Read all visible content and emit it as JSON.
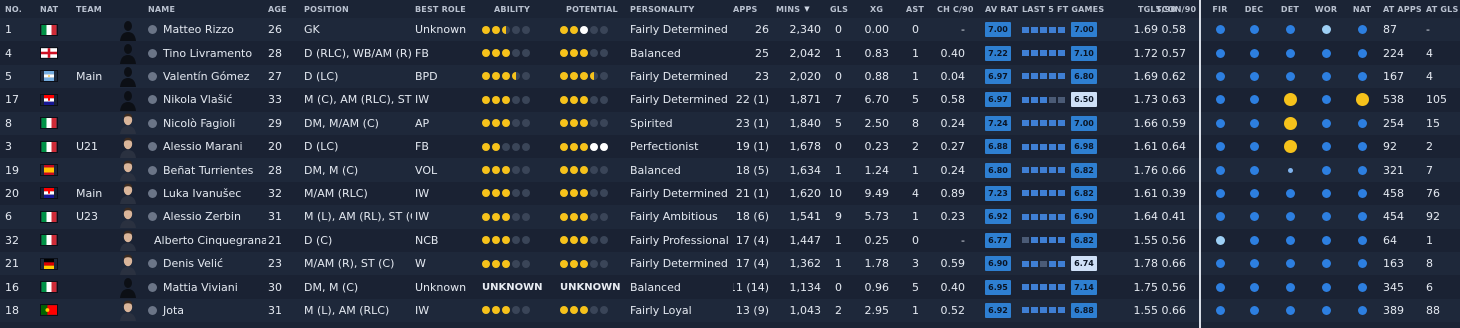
{
  "columns": {
    "no": "NO.",
    "nat": "NAT",
    "team": "TEAM",
    "name": "NAME",
    "age": "AGE",
    "position": "POSITION",
    "best_role": "BEST ROLE",
    "ability": "ABILITY",
    "potential": "POTENTIAL",
    "personality": "PERSONALITY",
    "apps": "APPS",
    "mins": "MINS",
    "mins_sort_icon": "▼",
    "gls": "GLS",
    "xg": "XG",
    "ast": "AST",
    "chc90": "CH C/90",
    "avrat": "AV RAT",
    "last5": "LAST 5 FT GAMES",
    "tgls90": "TGLS/90",
    "tcon90": "TCON/90",
    "fir": "FIR",
    "dec": "DEC",
    "det": "DET",
    "wor": "WOR",
    "nat2": "NAT",
    "atapps": "AT APPS",
    "atgls": "AT GLS"
  },
  "colors": {
    "background": "#1b2435",
    "row_alt": "#1e283a",
    "gold": "#f6c21b",
    "rating_blue": "#2e7fd1",
    "attr_blue": "#2d7fe0"
  },
  "players": [
    {
      "no": "1",
      "nat": "Italy",
      "flag": "it",
      "team": "",
      "name": "Matteo Rizzo",
      "age": "26",
      "position": "GK",
      "role": "Unknown",
      "ability": [
        "f",
        "f",
        "h",
        "e",
        "e"
      ],
      "potential": [
        "f",
        "f",
        "w",
        "e",
        "e"
      ],
      "ability_text": "",
      "potential_text": "",
      "personality": "Fairly Determined",
      "apps": "26",
      "mins": "2,340",
      "gls": "0",
      "xg": "0.00",
      "ast": "0",
      "chc90": "-",
      "avrat": "7.00",
      "avrat_light": false,
      "last5": [
        1,
        1,
        1,
        1,
        1
      ],
      "last5_rating": "7.00",
      "last5_light": false,
      "tgls90": "1.69",
      "tcon90": "0.58",
      "attrs": [
        "n",
        "n",
        "n",
        "l",
        "n"
      ],
      "atapps": "87",
      "atgls": "-",
      "photo": "silhouette"
    },
    {
      "no": "4",
      "nat": "England",
      "flag": "en",
      "team": "",
      "name": "Tino Livramento",
      "age": "28",
      "position": "D (RLC), WB/AM (R)",
      "role": "FB",
      "ability": [
        "f",
        "f",
        "f",
        "e",
        "e"
      ],
      "potential": [
        "f",
        "f",
        "f",
        "e",
        "e"
      ],
      "ability_text": "",
      "potential_text": "",
      "personality": "Balanced",
      "apps": "25",
      "mins": "2,042",
      "gls": "1",
      "xg": "0.83",
      "ast": "1",
      "chc90": "0.40",
      "avrat": "7.22",
      "avrat_light": false,
      "last5": [
        1,
        1,
        1,
        1,
        1
      ],
      "last5_rating": "7.10",
      "last5_light": false,
      "tgls90": "1.72",
      "tcon90": "0.57",
      "attrs": [
        "n",
        "n",
        "n",
        "n",
        "n"
      ],
      "atapps": "224",
      "atgls": "4",
      "photo": "silhouette"
    },
    {
      "no": "5",
      "nat": "Argentina",
      "flag": "ar",
      "team": "Main",
      "name": "Valentín Gómez",
      "age": "27",
      "position": "D (LC)",
      "role": "BPD",
      "ability": [
        "f",
        "f",
        "f",
        "h",
        "e"
      ],
      "potential": [
        "f",
        "f",
        "f",
        "h",
        "e"
      ],
      "ability_text": "",
      "potential_text": "",
      "personality": "Fairly Determined",
      "apps": "23",
      "mins": "2,020",
      "gls": "0",
      "xg": "0.88",
      "ast": "1",
      "chc90": "0.04",
      "avrat": "6.97",
      "avrat_light": false,
      "last5": [
        1,
        1,
        1,
        1,
        1
      ],
      "last5_rating": "6.80",
      "last5_light": false,
      "tgls90": "1.69",
      "tcon90": "0.62",
      "attrs": [
        "n",
        "n",
        "n",
        "n",
        "n"
      ],
      "atapps": "167",
      "atgls": "4",
      "photo": "silhouette"
    },
    {
      "no": "17",
      "nat": "Croatia",
      "flag": "hr",
      "team": "",
      "name": "Nikola Vlašić",
      "age": "33",
      "position": "M (C), AM (RLC), ST (C)",
      "role": "IW",
      "ability": [
        "f",
        "f",
        "f",
        "e",
        "e"
      ],
      "potential": [
        "f",
        "f",
        "f",
        "e",
        "e"
      ],
      "ability_text": "",
      "potential_text": "",
      "personality": "Fairly Determined",
      "apps": "22 (1)",
      "mins": "1,871",
      "gls": "7",
      "xg": "6.70",
      "ast": "5",
      "chc90": "0.58",
      "avrat": "6.97",
      "avrat_light": false,
      "last5": [
        1,
        1,
        1,
        0,
        0
      ],
      "last5_rating": "6.50",
      "last5_light": true,
      "tgls90": "1.73",
      "tcon90": "0.63",
      "attrs": [
        "n",
        "n",
        "g",
        "n",
        "g"
      ],
      "atapps": "538",
      "atgls": "105",
      "photo": "silhouette"
    },
    {
      "no": "8",
      "nat": "Italy",
      "flag": "it",
      "team": "",
      "name": "Nicolò Fagioli",
      "age": "29",
      "position": "DM, M/AM (C)",
      "role": "AP",
      "ability": [
        "f",
        "f",
        "f",
        "e",
        "e"
      ],
      "potential": [
        "f",
        "f",
        "f",
        "e",
        "e"
      ],
      "ability_text": "",
      "potential_text": "",
      "personality": "Spirited",
      "apps": "23 (1)",
      "mins": "1,840",
      "gls": "5",
      "xg": "2.50",
      "ast": "8",
      "chc90": "0.24",
      "avrat": "7.24",
      "avrat_light": false,
      "last5": [
        1,
        1,
        1,
        1,
        1
      ],
      "last5_rating": "7.00",
      "last5_light": false,
      "tgls90": "1.66",
      "tcon90": "0.59",
      "attrs": [
        "n",
        "n",
        "g",
        "n",
        "n"
      ],
      "atapps": "254",
      "atgls": "15",
      "photo": "face"
    },
    {
      "no": "3",
      "nat": "Italy",
      "flag": "it",
      "team": "U21",
      "name": "Alessio Marani",
      "age": "20",
      "position": "D (LC)",
      "role": "FB",
      "ability": [
        "f",
        "f",
        "e",
        "e",
        "e"
      ],
      "potential": [
        "f",
        "f",
        "f",
        "w",
        "w"
      ],
      "ability_text": "",
      "potential_text": "",
      "personality": "Perfectionist",
      "apps": "19 (1)",
      "mins": "1,678",
      "gls": "0",
      "xg": "0.23",
      "ast": "2",
      "chc90": "0.27",
      "avrat": "6.88",
      "avrat_light": false,
      "last5": [
        1,
        1,
        1,
        1,
        1
      ],
      "last5_rating": "6.98",
      "last5_light": false,
      "tgls90": "1.61",
      "tcon90": "0.64",
      "attrs": [
        "n",
        "n",
        "g",
        "n",
        "n"
      ],
      "atapps": "92",
      "atgls": "2",
      "photo": "face"
    },
    {
      "no": "19",
      "nat": "Spain",
      "flag": "es",
      "team": "",
      "name": "Beñat Turrientes",
      "age": "28",
      "position": "DM, M (C)",
      "role": "VOL",
      "ability": [
        "f",
        "f",
        "f",
        "e",
        "e"
      ],
      "potential": [
        "f",
        "f",
        "f",
        "e",
        "e"
      ],
      "ability_text": "",
      "potential_text": "",
      "personality": "Balanced",
      "apps": "18 (5)",
      "mins": "1,634",
      "gls": "1",
      "xg": "1.24",
      "ast": "1",
      "chc90": "0.24",
      "avrat": "6.80",
      "avrat_light": false,
      "last5": [
        1,
        1,
        1,
        1,
        1
      ],
      "last5_rating": "6.82",
      "last5_light": false,
      "tgls90": "1.76",
      "tcon90": "0.66",
      "attrs": [
        "n",
        "n",
        "s",
        "n",
        "n"
      ],
      "atapps": "321",
      "atgls": "7",
      "photo": "face"
    },
    {
      "no": "20",
      "nat": "Croatia",
      "flag": "hr",
      "team": "Main",
      "name": "Luka Ivanušec",
      "age": "32",
      "position": "M/AM (RLC)",
      "role": "IW",
      "ability": [
        "f",
        "f",
        "f",
        "e",
        "e"
      ],
      "potential": [
        "f",
        "f",
        "f",
        "e",
        "e"
      ],
      "ability_text": "",
      "potential_text": "",
      "personality": "Fairly Determined",
      "apps": "21 (1)",
      "mins": "1,620",
      "gls": "10",
      "xg": "9.49",
      "ast": "4",
      "chc90": "0.89",
      "avrat": "7.23",
      "avrat_light": false,
      "last5": [
        1,
        1,
        1,
        1,
        1
      ],
      "last5_rating": "6.82",
      "last5_light": false,
      "tgls90": "1.61",
      "tcon90": "0.39",
      "attrs": [
        "n",
        "n",
        "n",
        "n",
        "n"
      ],
      "atapps": "458",
      "atgls": "76",
      "photo": "face"
    },
    {
      "no": "6",
      "nat": "Italy",
      "flag": "it",
      "team": "U23",
      "name": "Alessio Zerbin",
      "age": "31",
      "position": "M (L), AM (RL), ST (C)",
      "role": "IW",
      "ability": [
        "f",
        "f",
        "f",
        "e",
        "e"
      ],
      "potential": [
        "f",
        "f",
        "f",
        "e",
        "e"
      ],
      "ability_text": "",
      "potential_text": "",
      "personality": "Fairly Ambitious",
      "apps": "18 (6)",
      "mins": "1,541",
      "gls": "9",
      "xg": "5.73",
      "ast": "1",
      "chc90": "0.23",
      "avrat": "6.92",
      "avrat_light": false,
      "last5": [
        1,
        1,
        1,
        1,
        1
      ],
      "last5_rating": "6.90",
      "last5_light": false,
      "tgls90": "1.64",
      "tcon90": "0.41",
      "attrs": [
        "n",
        "n",
        "n",
        "n",
        "n"
      ],
      "atapps": "454",
      "atgls": "92",
      "photo": "face"
    },
    {
      "no": "32",
      "nat": "Italy",
      "flag": "it",
      "team": "",
      "name": "Alberto Cinquegrana",
      "age": "21",
      "position": "D (C)",
      "role": "NCB",
      "ability": [
        "f",
        "f",
        "f",
        "e",
        "e"
      ],
      "potential": [
        "f",
        "f",
        "f",
        "e",
        "e"
      ],
      "ability_text": "",
      "potential_text": "",
      "personality": "Fairly Professional",
      "apps": "17 (4)",
      "mins": "1,447",
      "gls": "1",
      "xg": "0.25",
      "ast": "0",
      "chc90": "-",
      "avrat": "6.77",
      "avrat_light": false,
      "last5": [
        0,
        1,
        1,
        1,
        1
      ],
      "last5_rating": "6.82",
      "last5_light": false,
      "tgls90": "1.55",
      "tcon90": "0.56",
      "attrs": [
        "l",
        "n",
        "n",
        "n",
        "n"
      ],
      "atapps": "64",
      "atgls": "1",
      "photo": "face"
    },
    {
      "no": "21",
      "nat": "Germany",
      "flag": "de",
      "team": "",
      "name": "Denis Velić",
      "age": "23",
      "position": "M/AM (R), ST (C)",
      "role": "W",
      "ability": [
        "f",
        "f",
        "f",
        "e",
        "e"
      ],
      "potential": [
        "f",
        "f",
        "f",
        "e",
        "e"
      ],
      "ability_text": "",
      "potential_text": "",
      "personality": "Fairly Determined",
      "apps": "17 (4)",
      "mins": "1,362",
      "gls": "1",
      "xg": "1.78",
      "ast": "3",
      "chc90": "0.59",
      "avrat": "6.90",
      "avrat_light": false,
      "last5": [
        1,
        1,
        0,
        1,
        1
      ],
      "last5_rating": "6.74",
      "last5_light": true,
      "tgls90": "1.78",
      "tcon90": "0.66",
      "attrs": [
        "n",
        "n",
        "n",
        "n",
        "n"
      ],
      "atapps": "163",
      "atgls": "8",
      "photo": "face"
    },
    {
      "no": "16",
      "nat": "Italy",
      "flag": "it",
      "team": "",
      "name": "Mattia Viviani",
      "age": "30",
      "position": "DM, M (C)",
      "role": "Unknown",
      "ability": [],
      "potential": [],
      "ability_text": "UNKNOWN",
      "potential_text": "UNKNOWN",
      "personality": "Balanced",
      "apps": "11 (14)",
      "mins": "1,134",
      "gls": "0",
      "xg": "0.96",
      "ast": "5",
      "chc90": "0.40",
      "avrat": "6.95",
      "avrat_light": false,
      "last5": [
        1,
        1,
        1,
        1,
        1
      ],
      "last5_rating": "7.14",
      "last5_light": false,
      "tgls90": "1.75",
      "tcon90": "0.56",
      "attrs": [
        "n",
        "n",
        "n",
        "n",
        "n"
      ],
      "atapps": "345",
      "atgls": "6",
      "photo": "silhouette"
    },
    {
      "no": "18",
      "nat": "Portugal",
      "flag": "pt",
      "team": "",
      "name": "Jota",
      "age": "31",
      "position": "M (L), AM (RLC)",
      "role": "IW",
      "ability": [
        "f",
        "f",
        "f",
        "e",
        "e"
      ],
      "potential": [
        "f",
        "f",
        "f",
        "e",
        "e"
      ],
      "ability_text": "",
      "potential_text": "",
      "personality": "Fairly Loyal",
      "apps": "13 (9)",
      "mins": "1,043",
      "gls": "2",
      "xg": "2.95",
      "ast": "1",
      "chc90": "0.52",
      "avrat": "6.92",
      "avrat_light": false,
      "last5": [
        1,
        1,
        1,
        1,
        1
      ],
      "last5_rating": "6.88",
      "last5_light": false,
      "tgls90": "1.55",
      "tcon90": "0.66",
      "attrs": [
        "n",
        "n",
        "n",
        "n",
        "n"
      ],
      "atapps": "389",
      "atgls": "88",
      "photo": "face"
    }
  ]
}
